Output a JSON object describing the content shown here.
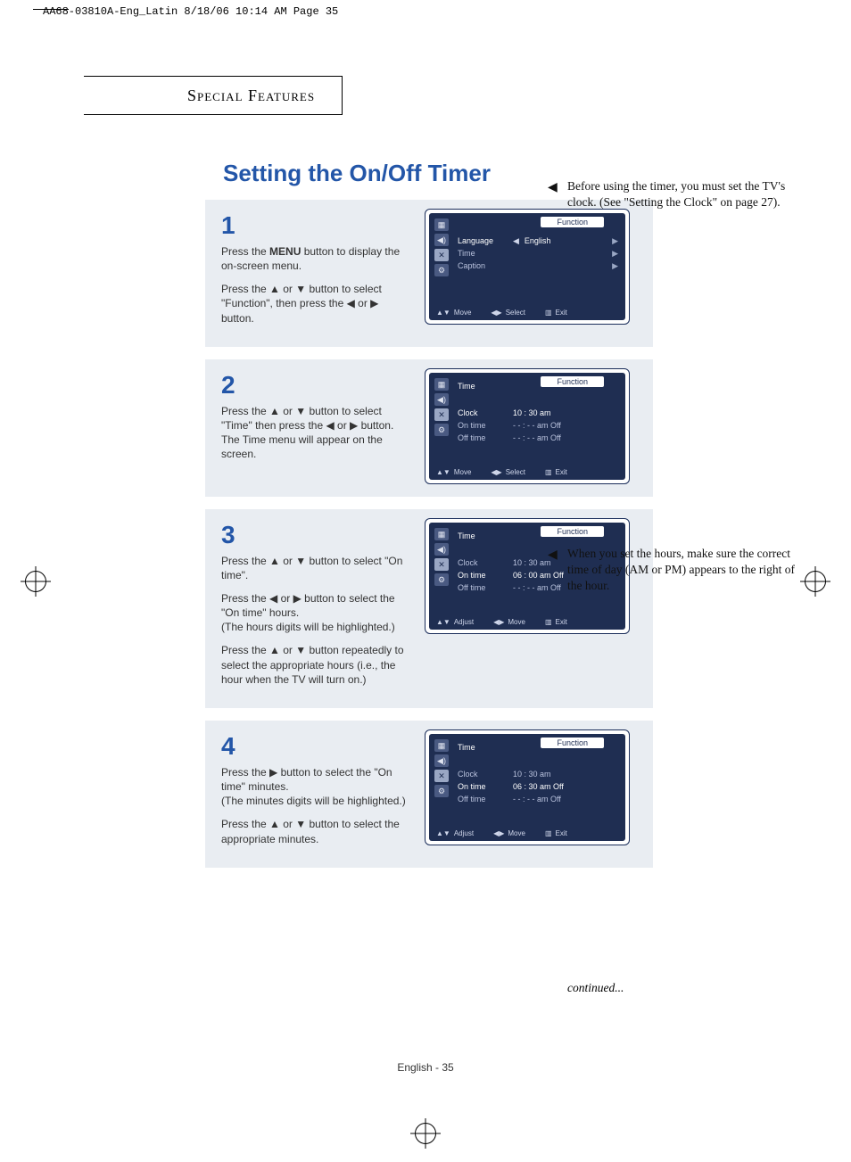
{
  "header_line": "AA68-03810A-Eng_Latin  8/18/06  10:14 AM  Page 35",
  "chapter": "Special Features",
  "title": "Setting the On/Off Timer",
  "footer": "English - 35",
  "continued": "continued...",
  "notes": {
    "n1": "Before using the timer, you must set the TV's clock. (See \"Setting the Clock\" on page 27).",
    "n2": "When you set the hours, make sure the correct time of day (AM or PM) appears to the right of the hour."
  },
  "steps": {
    "s1": {
      "num": "1",
      "p1_a": "Press the ",
      "p1_b": "MENU",
      "p1_c": " button to display the on-screen menu.",
      "p2": "Press the ▲ or ▼ button to select \"Function\", then press the ◀ or ▶ button."
    },
    "s2": {
      "num": "2",
      "p1": "Press the ▲ or ▼ button to select \"Time\" then press the ◀ or ▶ button. The Time menu will appear on the screen."
    },
    "s3": {
      "num": "3",
      "p1": "Press the ▲ or ▼ button to select \"On time\".",
      "p2": "Press the ◀ or ▶ button to select the \"On time\" hours.",
      "p2b": "(The hours digits will be highlighted.)",
      "p3": "Press the ▲ or ▼ button repeatedly to select the appropriate hours (i.e., the hour when the TV will turn on.)"
    },
    "s4": {
      "num": "4",
      "p1": "Press the ▶ button to select the \"On time\" minutes.",
      "p1b": "(The minutes digits will be highlighted.)",
      "p2": "Press the ▲ or ▼ button to select the appropriate minutes."
    }
  },
  "osd": {
    "pill": "Function",
    "help_move": "Move",
    "help_select": "Select",
    "help_adjust": "Adjust",
    "help_exit": "Exit",
    "s1": {
      "r1": "Language",
      "r1v": "English",
      "r2": "Time",
      "r3": "Caption"
    },
    "time": {
      "title": "Time",
      "clock_l": "Clock",
      "clock_v": "10 : 30 am",
      "on_l": "On time",
      "off_l": "Off time",
      "blank": "- -  :  - - am   Off",
      "on_v3": "06 : 00 am   Off",
      "on_v4": "06 : 30 am   Off"
    }
  }
}
